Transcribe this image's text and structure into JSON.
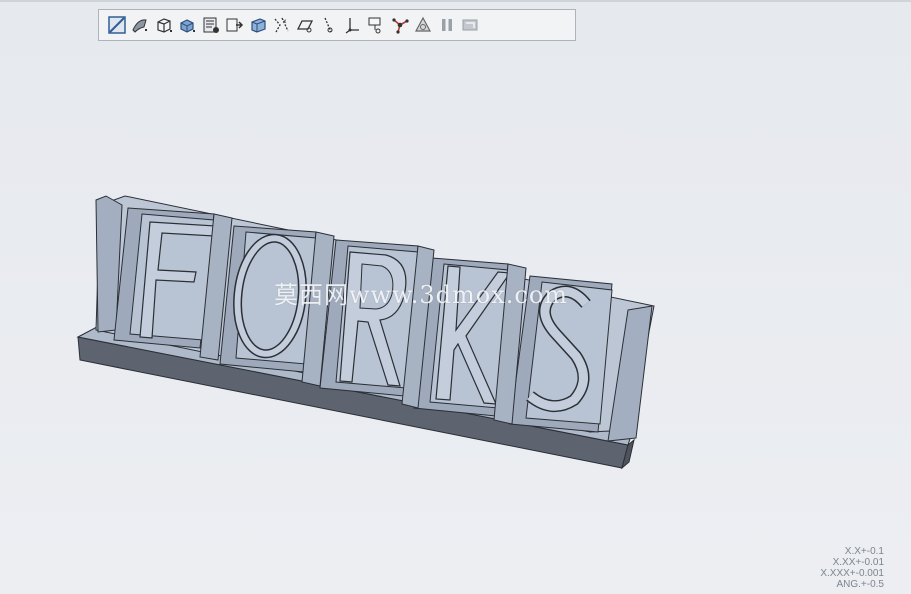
{
  "toolbar": {
    "icons": [
      "refit-icon",
      "repaint-icon",
      "saved-orientations-icon",
      "display-style-icon",
      "view-manager-icon",
      "named-views-icon",
      "perspective-icon",
      "plane-display-icon",
      "axis-display-icon",
      "point-display-icon",
      "csys-display-icon",
      "annotation-display-icon",
      "spin-center-icon",
      "orient-mode-icon",
      "pause-icon",
      "close-model-icon"
    ]
  },
  "model": {
    "letters": [
      "F",
      "O",
      "R",
      "K",
      "S"
    ]
  },
  "watermark": {
    "text": "莫西网www.3dmox.com"
  },
  "tolerance": {
    "line1": "X.X+-0.1",
    "line2": "X.XX+-0.01",
    "line3": "X.XXX+-0.001",
    "line4": "ANG.+-0.5"
  },
  "colors": {
    "background": "#e8ebf0",
    "model_face": "#b8c3d3",
    "model_dark": "#5c6370",
    "model_edge": "#2b2f36"
  }
}
